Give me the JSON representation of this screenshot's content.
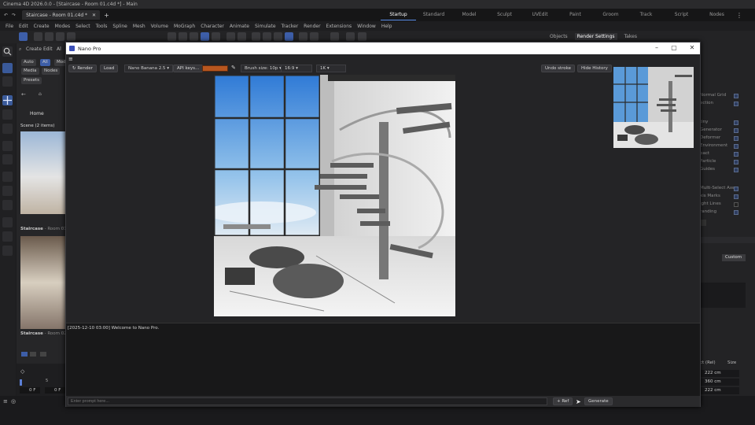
{
  "app": {
    "title": "Cinema 4D 2026.0.0 - [Staircase - Room 01.c4d *] - Main",
    "tab_label": "Staircase - Room 01.c4d *",
    "layouts": [
      "Startup",
      "Standard",
      "Model",
      "Sculpt",
      "UVEdit",
      "Paint",
      "Groom",
      "Track",
      "Script",
      "Nodes"
    ],
    "active_layout": "Startup"
  },
  "menubar": [
    "File",
    "Edit",
    "Create",
    "Modes",
    "Select",
    "Tools",
    "Spline",
    "Mesh",
    "Volume",
    "MoGraph",
    "Character",
    "Animate",
    "Simulate",
    "Tracker",
    "Render",
    "Extensions",
    "Window",
    "Help"
  ],
  "asset_browser": {
    "row1": [
      "Auto",
      "All",
      "Mod"
    ],
    "row2": [
      "Media",
      "Nodes"
    ],
    "presets_label": "Presets",
    "home_label": "Home",
    "scene_header": "Scene (2 items)",
    "items": [
      {
        "name": "Staircase",
        "detail": " - Room 01.c4"
      },
      {
        "name": "Staircase",
        "detail": " - Room 02.c4"
      }
    ],
    "timeline": {
      "frame_a": "0 F",
      "frame_b": "0 F",
      "tick": "5"
    }
  },
  "right_panel": {
    "tabs": [
      "Objects",
      "Render Settings",
      "Takes"
    ],
    "active_tab": "Render Settings",
    "rows": [
      "Normal Grid",
      "ection",
      "tiny",
      "Generator",
      "Deformer",
      "Environment",
      "pact",
      "Particle",
      "Guides",
      "Multi-Select Axes",
      "xis Marks",
      "ight Lines",
      "randing"
    ],
    "dropdown_label": "Custom",
    "coord_label": "ct (Rel)",
    "size_label": "Size",
    "values": [
      "222 cm",
      "360 cm",
      "222 cm"
    ]
  },
  "nano_pro": {
    "window_title": "Nano Pro",
    "render_btn": "↻ Render",
    "load_btn": "Load",
    "model_drop": "Nano Banana 2.5",
    "api_btn": "API keys...",
    "brush_drop": "Brush size: 10p",
    "ratio_drop": "16:9",
    "res_drop": "1K",
    "undo_btn": "Undo stroke",
    "hide_history_btn": "Hide History",
    "console_log": "[2025-12-10 03:00] Welcome to Nano Pro.",
    "prompt_placeholder": "Enter prompt here...",
    "ref_btn": "+ Ref",
    "generate_btn": "Generate",
    "brush_color": "#b8561f"
  }
}
